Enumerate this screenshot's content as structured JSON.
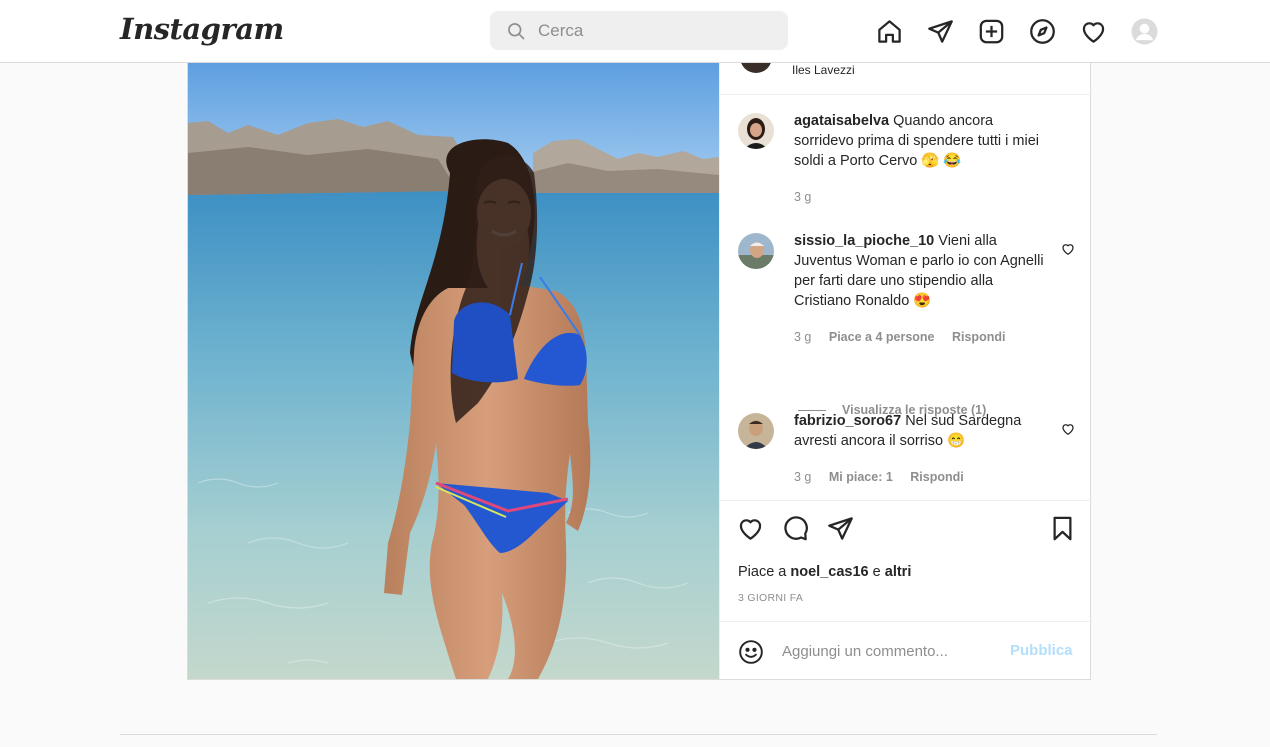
{
  "header": {
    "logo_text": "Instagram",
    "search": {
      "placeholder": "Cerca"
    },
    "nav_icons": [
      "home-icon",
      "direct-icon",
      "new-post-icon",
      "explore-icon",
      "activity-icon",
      "profile-avatar"
    ]
  },
  "post": {
    "location": "Iles Lavezzi",
    "comments": [
      {
        "username": "agataisabelva",
        "text": "Quando ancora sorridevo prima di spendere tutti i miei soldi a Porto Cervo 🫣 😂",
        "time": "3 g"
      },
      {
        "username": "sissio_la_pioche_10",
        "text": "Vieni alla Juventus Woman e parlo io con Agnelli per farti dare uno stipendio alla Cristiano Ronaldo 😍",
        "time": "3 g",
        "likes": "Piace a 4 persone",
        "reply": "Rispondi",
        "view_replies": "Visualizza le risposte (1)"
      },
      {
        "username": "fabrizio_soro67",
        "text": "Nel sud Sardegna avresti ancora il sorriso 😁",
        "time": "3 g",
        "likes": "Mi piace: 1",
        "reply": "Rispondi"
      }
    ],
    "likes": {
      "prefix": "Piace a",
      "user": "noel_cas16",
      "conj": "e",
      "others": "altri"
    },
    "date": "3 GIORNI FA",
    "add_comment": {
      "placeholder": "Aggiungi un commento...",
      "publish": "Pubblica"
    }
  },
  "colors": {
    "publish_disabled": "#b2dffc",
    "muted_text": "#8e8e8e",
    "border": "#dbdbdb"
  }
}
